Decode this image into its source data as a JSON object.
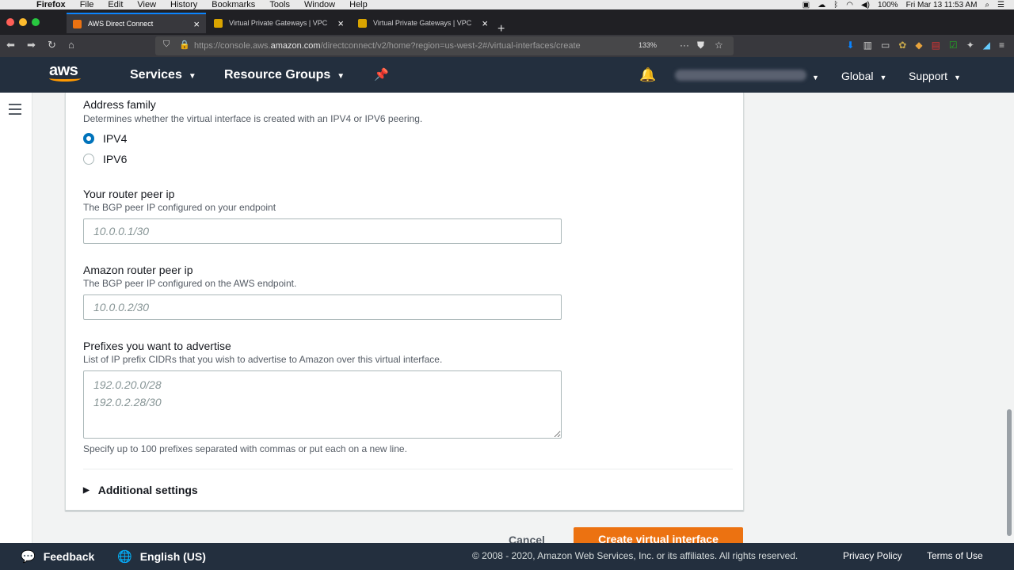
{
  "mac_menu": {
    "app": "Firefox",
    "items": [
      "File",
      "Edit",
      "View",
      "History",
      "Bookmarks",
      "Tools",
      "Window",
      "Help"
    ],
    "battery": "100%",
    "datetime": "Fri Mar 13  11:53 AM"
  },
  "browser": {
    "tabs": [
      {
        "label": "AWS Direct Connect",
        "active": true
      },
      {
        "label": "Virtual Private Gateways | VPC",
        "active": false
      },
      {
        "label": "Virtual Private Gateways | VPC",
        "active": false
      }
    ],
    "url_prefix": "https://console.aws.",
    "url_domain": "amazon.com",
    "url_path": "/directconnect/v2/home?region=us-west-2#/virtual-interfaces/create",
    "zoom": "133%"
  },
  "aws_header": {
    "logo": "aws",
    "services": "Services",
    "resource_groups": "Resource Groups",
    "region": "Global",
    "support": "Support"
  },
  "form": {
    "address_family": {
      "label": "Address family",
      "description": "Determines whether the virtual interface is created with an IPV4 or IPV6 peering.",
      "options": [
        "IPV4",
        "IPV6"
      ],
      "selected": "IPV4"
    },
    "router_peer_ip": {
      "label": "Your router peer ip",
      "description": "The BGP peer IP configured on your endpoint",
      "placeholder": "10.0.0.1/30",
      "value": ""
    },
    "amazon_peer_ip": {
      "label": "Amazon router peer ip",
      "description": "The BGP peer IP configured on the AWS endpoint.",
      "placeholder": "10.0.0.2/30",
      "value": ""
    },
    "prefixes": {
      "label": "Prefixes you want to advertise",
      "description": "List of IP prefix CIDRs that you wish to advertise to Amazon over this virtual interface.",
      "placeholder": "192.0.20.0/28\n192.0.2.28/30",
      "hint": "Specify up to 100 prefixes separated with commas or put each on a new line."
    },
    "additional_settings": "Additional settings",
    "cancel": "Cancel",
    "create": "Create virtual interface"
  },
  "footer": {
    "feedback": "Feedback",
    "language": "English (US)",
    "copyright": "© 2008 - 2020, Amazon Web Services, Inc. or its affiliates. All rights reserved.",
    "privacy": "Privacy Policy",
    "terms": "Terms of Use"
  },
  "colors": {
    "aws_nav": "#232f3e",
    "aws_orange": "#ec7211",
    "radio_selected": "#0073bb"
  }
}
